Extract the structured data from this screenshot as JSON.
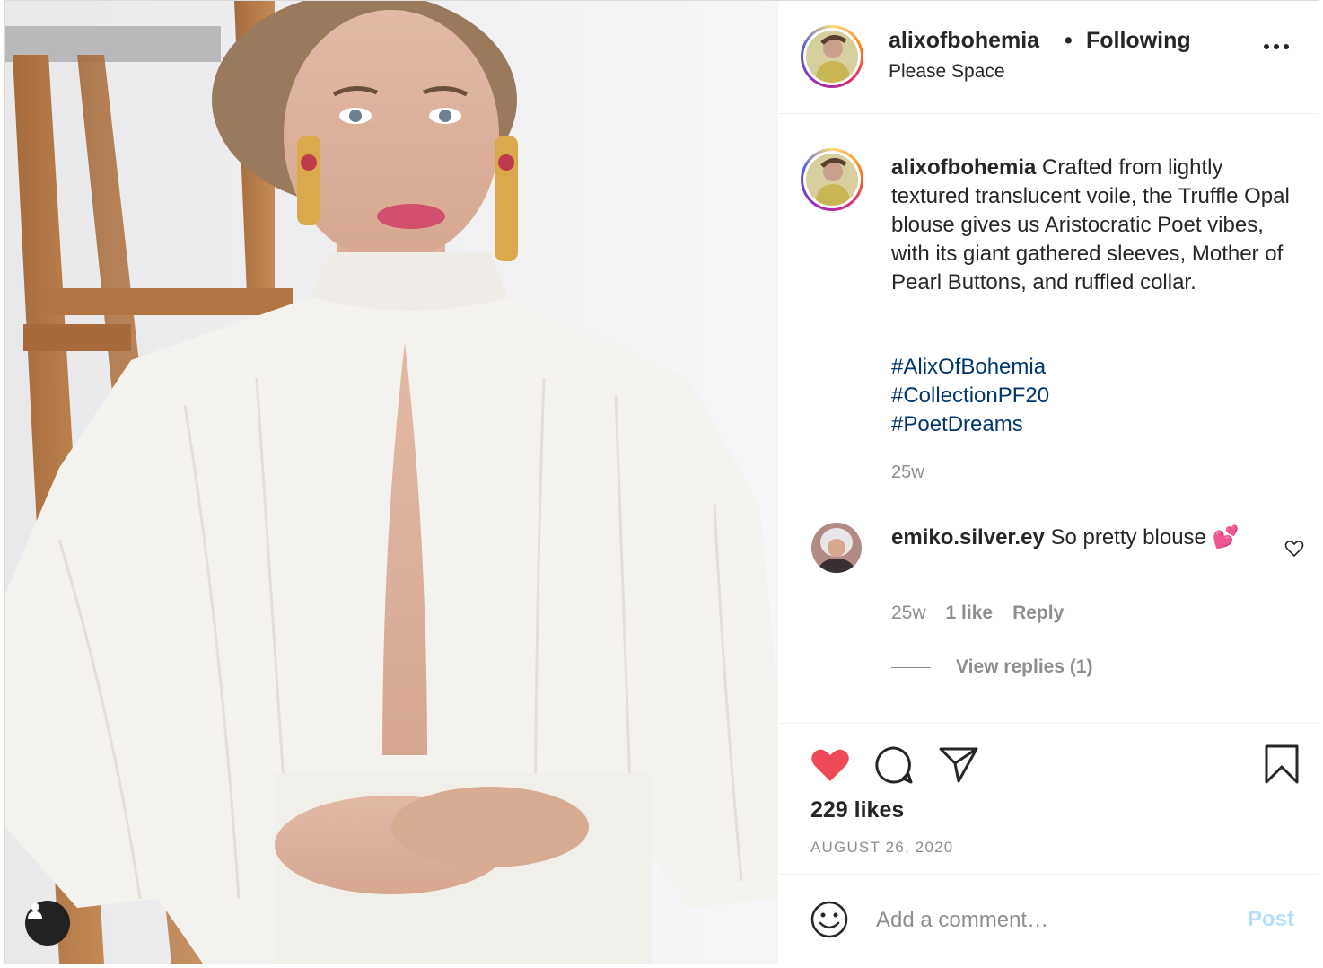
{
  "post": {
    "author": "alixofbohemia",
    "follow_dot": "•",
    "follow_status": "Following",
    "location": "Please Space",
    "caption": {
      "username": "alixofbohemia",
      "text": "Crafted from lightly textured translucent voile, the Truffle Opal blouse gives us Aristocratic Poet vibes, with its giant gathered sleeves, Mother of Pearl Buttons, and ruffled collar.",
      "hashtags": [
        "#AlixOfBohemia",
        "#CollectionPF20",
        "#PoetDreams"
      ],
      "time": "25w"
    },
    "comment": {
      "username": "emiko.silver.ey",
      "text": "So pretty blouse 💕",
      "time": "25w",
      "likes": "1 like",
      "reply_label": "Reply",
      "view_replies": "View replies (1)"
    },
    "likes": "229 likes",
    "date": "AUGUST 26, 2020",
    "add_comment": {
      "placeholder": "Add a comment…",
      "post_label": "Post"
    }
  },
  "icons": {
    "more": "more-options-icon",
    "like": "heart-icon",
    "comment": "comment-icon",
    "share": "share-icon",
    "save": "bookmark-icon",
    "emoji": "emoji-icon",
    "tag_user": "user-tag-icon",
    "comment_like": "heart-outline-icon"
  },
  "colors": {
    "like_active": "#ed4956",
    "hashtag": "#00376b",
    "secondary_text": "#8e8e8e",
    "post_disabled": "#b2dffc"
  }
}
